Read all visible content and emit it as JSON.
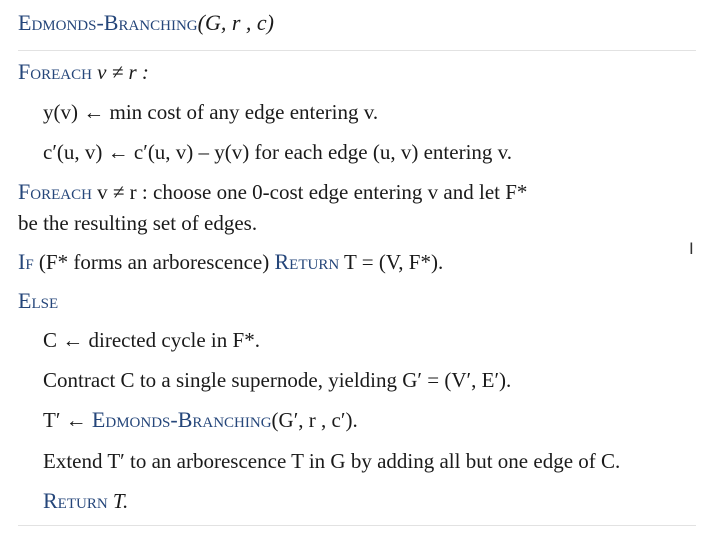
{
  "title": {
    "name": "Edmonds-Branching",
    "args": "(G, r , c)"
  },
  "lines": {
    "l1": {
      "kw": "Foreach",
      "text": " v ≠ r :"
    },
    "l2": {
      "text": "y(v)  ←  min cost of any edge entering v."
    },
    "l3": {
      "text": "c′(u, v)  ←  c′(u, v) –  y(v) for each edge (u, v) entering v."
    },
    "l4": {
      "kw": "Foreach",
      "text": " v ≠ r : choose one 0-cost edge entering v and let F*"
    },
    "l5": {
      "text": "be the resulting set of edges."
    },
    "l6": {
      "kw1": "If",
      "text1": "  (F* forms an arborescence) ",
      "kw2": "Return",
      "text2": " T = (V, F*)."
    },
    "l7": {
      "kw": "Else"
    },
    "l8": {
      "text": "C ← directed cycle in F*."
    },
    "l9": {
      "text": "Contract C to a single supernode, yielding G′ = (V′, E′)."
    },
    "l10": {
      "text1": "T′ ← ",
      "kw": "Edmonds-Branching",
      "text2": "(G′, r , c′)."
    },
    "l11": {
      "text": "Extend T′ to an arborescence T in G by adding all but one edge of C."
    },
    "l12": {
      "kw": "Return",
      "text": " T."
    }
  },
  "cursor": "I"
}
